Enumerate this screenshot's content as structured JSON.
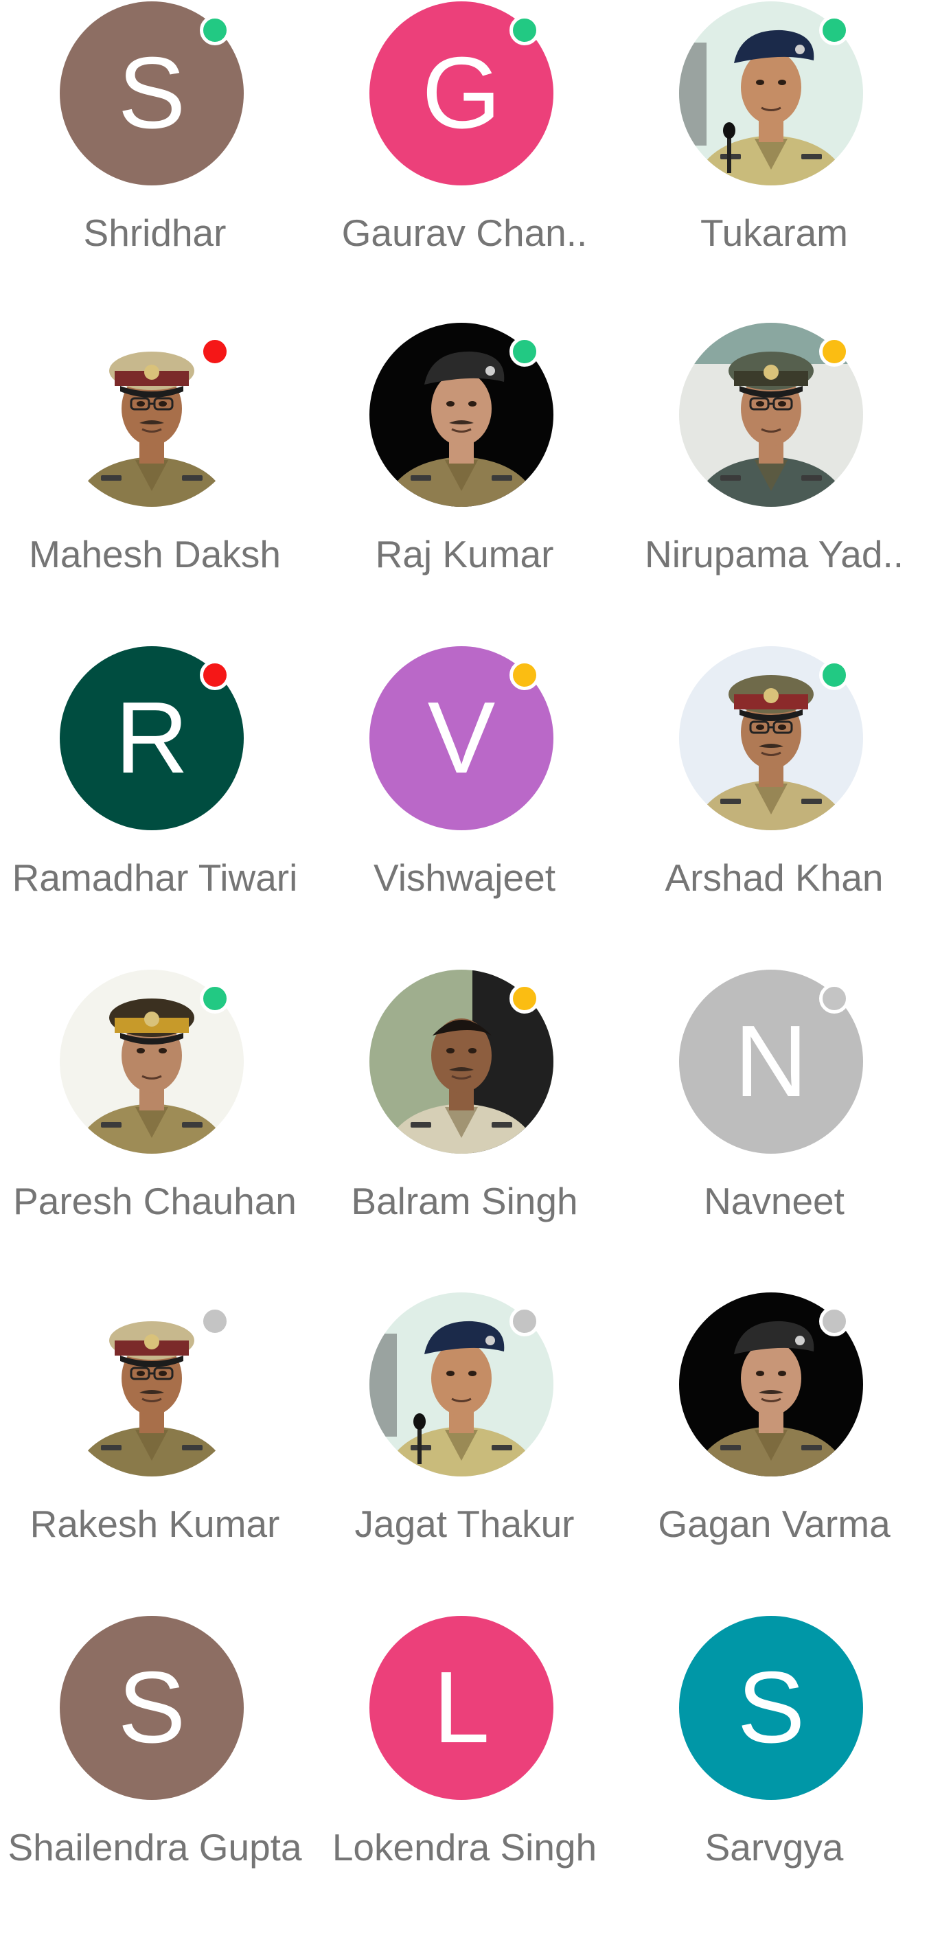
{
  "colors": {
    "status": {
      "online": "#22c983",
      "busy": "#f51717",
      "away": "#fbbd12",
      "offline": "#c4c4c4"
    },
    "name_text": "#757575"
  },
  "contacts": [
    {
      "name": "Shridhar",
      "type": "initial",
      "initial": "S",
      "bg": "#8d6e63",
      "status": "online"
    },
    {
      "name": "Gaurav Chan..",
      "type": "initial",
      "initial": "G",
      "bg": "#ec407a",
      "status": "online"
    },
    {
      "name": "Tukaram",
      "type": "photo",
      "photo": "officer-speaking",
      "status": "online"
    },
    {
      "name": "Mahesh Daksh",
      "type": "photo",
      "photo": "officer-peaked-cap",
      "status": "busy"
    },
    {
      "name": "Raj Kumar",
      "type": "photo",
      "photo": "officer-beret-dark",
      "status": "online"
    },
    {
      "name": "Nirupama Yad..",
      "type": "photo",
      "photo": "officer-female-cap",
      "status": "away"
    },
    {
      "name": "Ramadhar Tiwari",
      "type": "initial",
      "initial": "R",
      "bg": "#004d40",
      "status": "busy"
    },
    {
      "name": "Vishwajeet",
      "type": "initial",
      "initial": "V",
      "bg": "#ba68c8",
      "status": "away"
    },
    {
      "name": "Arshad Khan",
      "type": "photo",
      "photo": "officer-peaked-cap-light",
      "status": "online"
    },
    {
      "name": "Paresh Chauhan",
      "type": "photo",
      "photo": "officer-khaki-cap",
      "status": "online"
    },
    {
      "name": "Balram Singh",
      "type": "photo",
      "photo": "officer-selfie",
      "status": "away"
    },
    {
      "name": "Navneet",
      "type": "initial",
      "initial": "N",
      "bg": "#bdbdbd",
      "status": "offline"
    },
    {
      "name": "Rakesh Kumar",
      "type": "photo",
      "photo": "officer-peaked-cap",
      "status": "offline"
    },
    {
      "name": "Jagat Thakur",
      "type": "photo",
      "photo": "officer-speaking",
      "status": "offline"
    },
    {
      "name": "Gagan Varma",
      "type": "photo",
      "photo": "officer-beret-dark",
      "status": "offline"
    },
    {
      "name": "Shailendra Gupta",
      "type": "initial",
      "initial": "S",
      "bg": "#8d6e63",
      "status": null
    },
    {
      "name": "Lokendra Singh",
      "type": "initial",
      "initial": "L",
      "bg": "#ec407a",
      "status": null
    },
    {
      "name": "Sarvgya",
      "type": "initial",
      "initial": "S",
      "bg": "#0097a7",
      "status": null
    }
  ]
}
